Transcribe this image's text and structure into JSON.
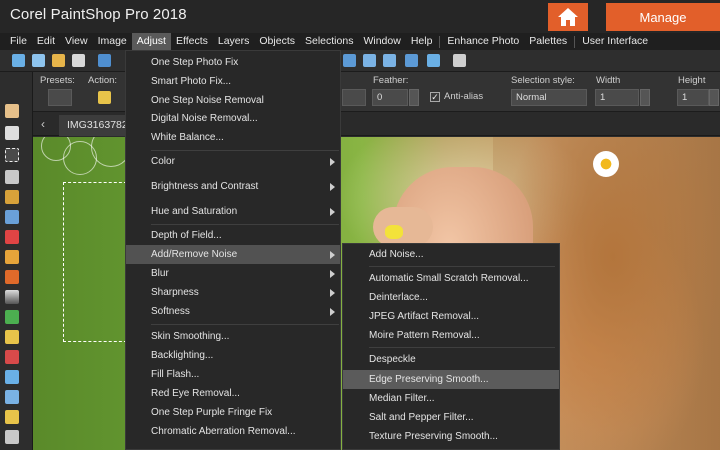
{
  "app": {
    "title": "Corel PaintShop Pro 2018",
    "manage_label": "Manage"
  },
  "menubar": {
    "items": [
      "File",
      "Edit",
      "View",
      "Image",
      "Adjust",
      "Effects",
      "Layers",
      "Objects",
      "Selections",
      "Window",
      "Help",
      "Enhance Photo",
      "Palettes",
      "User Interface"
    ],
    "active": "Adjust"
  },
  "options": {
    "presets_label": "Presets:",
    "action_label": "Action:",
    "feather_label": "Feather:",
    "feather_value": "0",
    "antialias_label": "Anti-alias",
    "antialias_checked": true,
    "selection_style_label": "Selection style:",
    "selection_style_value": "Normal",
    "width_label": "Width",
    "width_value": "1",
    "height_label": "Height",
    "height_value": "1"
  },
  "tab": {
    "label": "IMG3163782"
  },
  "adjust_menu": {
    "items": [
      "One Step Photo Fix",
      "Smart Photo Fix...",
      "One Step Noise Removal",
      "Digital Noise Removal...",
      "White Balance...",
      "Color",
      "Brightness and Contrast",
      "Hue and Saturation",
      "Depth of Field...",
      "Add/Remove Noise",
      "Blur",
      "Sharpness",
      "Softness",
      "Skin Smoothing...",
      "Backlighting...",
      "Fill Flash...",
      "Red Eye Removal...",
      "One Step Purple Fringe Fix",
      "Chromatic Aberration Removal..."
    ],
    "highlighted": "Add/Remove Noise"
  },
  "noise_submenu": {
    "items": [
      "Add Noise...",
      "Automatic Small Scratch Removal...",
      "Deinterlace...",
      "JPEG Artifact Removal...",
      "Moire Pattern Removal...",
      "Despeckle",
      "Edge Preserving Smooth...",
      "Median Filter...",
      "Salt and Pepper Filter...",
      "Texture Preserving Smooth..."
    ],
    "highlighted": "Edge Preserving Smooth..."
  },
  "colors": {
    "accent": "#e25f2a",
    "menu_bg": "#282828",
    "highlight": "#525252"
  }
}
